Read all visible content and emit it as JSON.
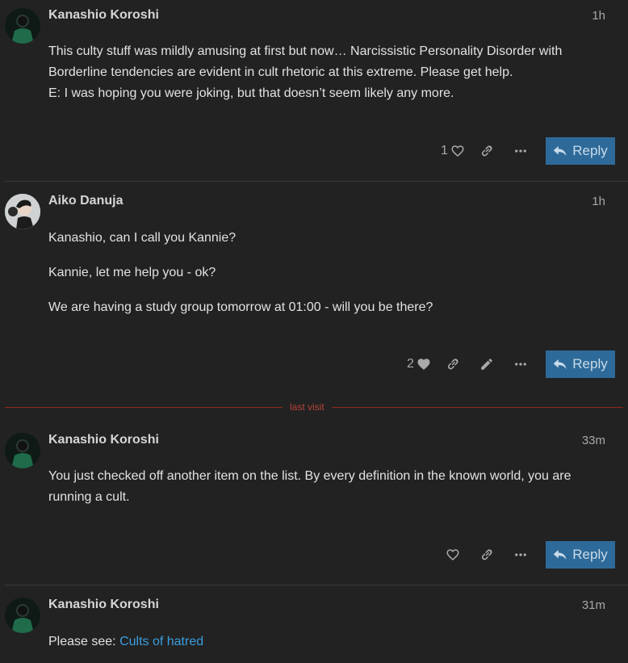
{
  "posts": [
    {
      "username": "Kanashio Koroshi",
      "time": "1h",
      "paragraphs": [
        "This culty stuff was mildly amusing at first but now… Narcissistic Personality Disorder with Borderline tendencies are evident in cult rhetoric at this extreme. Please get help.",
        "E: I was hoping you were joking, but that doesn’t seem likely any more."
      ],
      "like_count": "1",
      "reply_label": "Reply"
    },
    {
      "username": "Aiko Danuja",
      "time": "1h",
      "paragraphs": [
        "Kanashio, can I call you Kannie?",
        "Kannie, let me help you - ok?",
        "We are having a study group tomorrow at 01:00 - will you be there?"
      ],
      "like_count": "2",
      "reply_label": "Reply"
    },
    {
      "username": "Kanashio Koroshi",
      "time": "33m",
      "paragraphs": [
        "You just checked off another item on the list. By every definition in the known world, you are running a cult."
      ],
      "reply_label": "Reply"
    },
    {
      "username": "Kanashio Koroshi",
      "time": "31m",
      "see_prefix": "Please see: ",
      "link_text": "Cults of hatred"
    }
  ],
  "last_visit_label": "last visit",
  "colors": {
    "background": "#222222",
    "reply_button": "#2e6a99",
    "last_visit": "#8f2a1f",
    "link": "#3a9ee0"
  }
}
